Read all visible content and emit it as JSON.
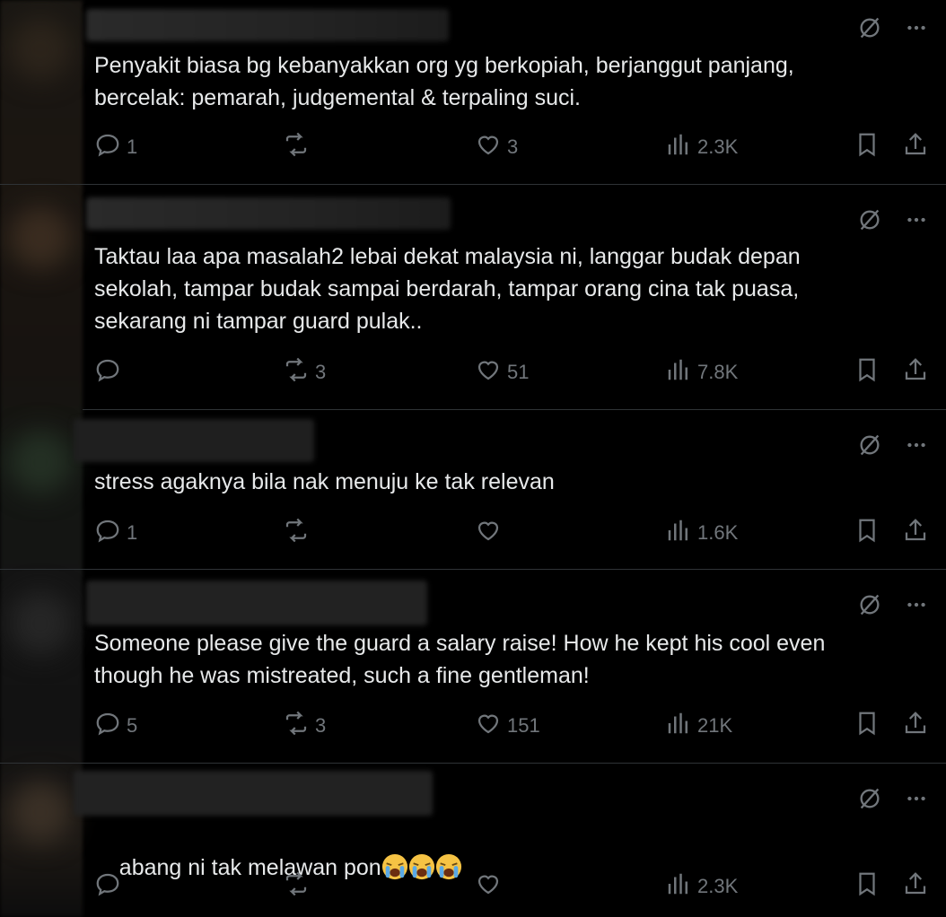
{
  "colors": {
    "background": "#000000",
    "text": "#e7e9ea",
    "muted": "#71767b",
    "divider": "#2f3336"
  },
  "replies": [
    {
      "text": "Penyakit biasa bg kebanyakkan org yg berkopiah, berjanggut panjang,\nbercelak: pemarah, judgemental & terpaling suci.",
      "reply_count": "1",
      "repost_count": "",
      "like_count": "3",
      "view_count": "2.3K"
    },
    {
      "text": "Taktau laa apa masalah2 lebai dekat malaysia ni, langgar budak depan\nsekolah, tampar budak sampai berdarah, tampar orang cina tak puasa,\nsekarang ni tampar guard pulak..",
      "reply_count": "",
      "repost_count": "3",
      "like_count": "51",
      "view_count": "7.8K"
    },
    {
      "text": "stress agaknya bila nak menuju ke tak relevan",
      "reply_count": "1",
      "repost_count": "",
      "like_count": "",
      "view_count": "1.6K"
    },
    {
      "text": "Someone please give the guard a salary raise! How he kept his cool even\nthough he was mistreated, such a fine gentleman!",
      "reply_count": "5",
      "repost_count": "3",
      "like_count": "151",
      "view_count": "21K"
    },
    {
      "text": "abang ni tak melawan pon",
      "emoji": "loudly-crying-face x3",
      "reply_count": "",
      "repost_count": "",
      "like_count": "",
      "view_count": "2.3K"
    }
  ],
  "icons": [
    "grok-icon",
    "more-icon",
    "reply-icon",
    "repost-icon",
    "like-icon",
    "views-icon",
    "bookmark-icon",
    "share-icon",
    "loudly-crying-face-emoji"
  ]
}
